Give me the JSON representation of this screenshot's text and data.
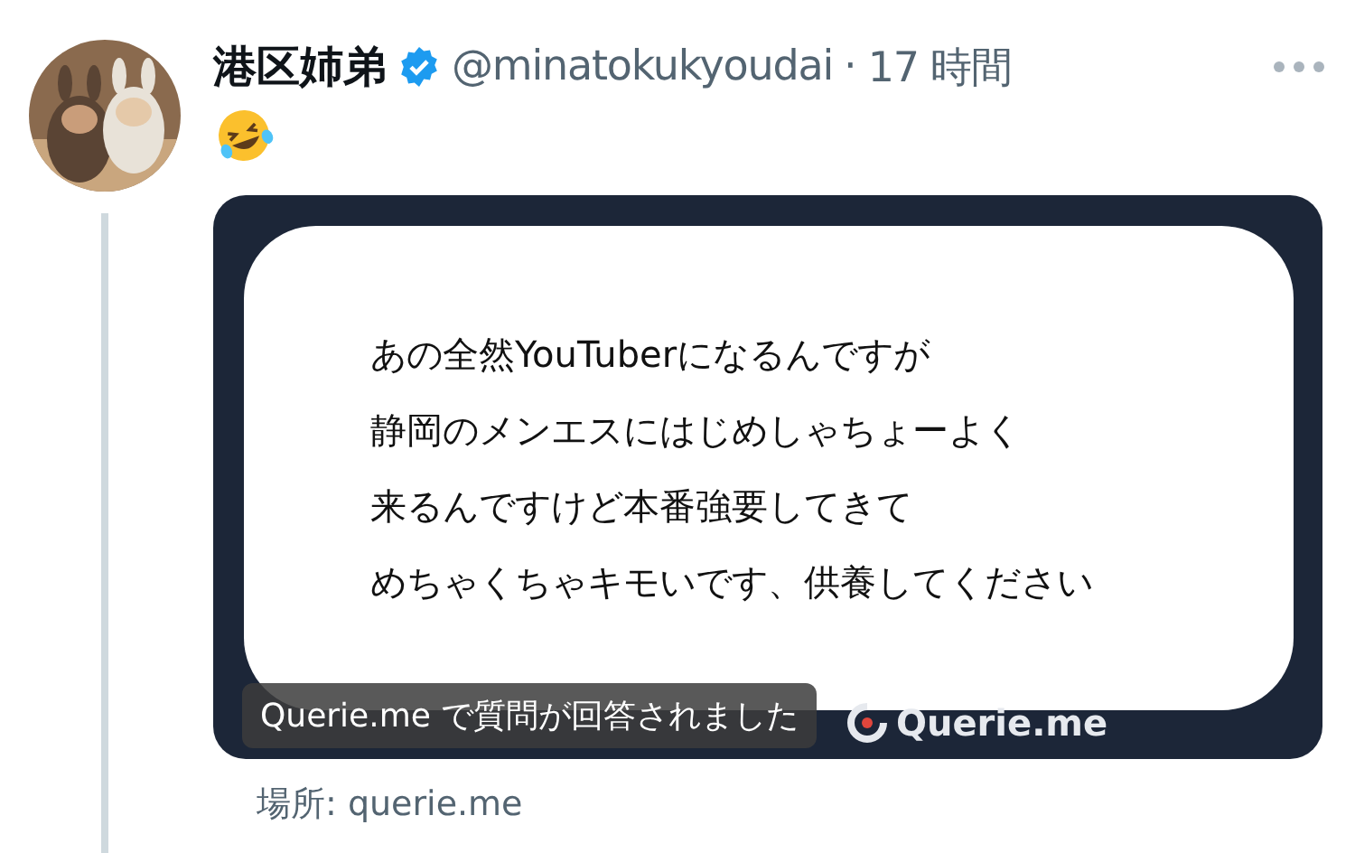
{
  "post": {
    "author": "港区姉弟",
    "verified": true,
    "handle": "@minatokukyoudai",
    "separator": "·",
    "time": "17 時間",
    "card": {
      "lines": [
        "あの全然YouTuberになるんですが",
        "静岡のメンエスにはじめしゃちょーよく",
        "来るんですけど本番強要してきて",
        "めちゃくちゃキモいです、供養してください"
      ],
      "logo_text": "Querie.me",
      "caption": "Querie.me で質問が回答されました"
    },
    "location": "場所: querie.me"
  }
}
